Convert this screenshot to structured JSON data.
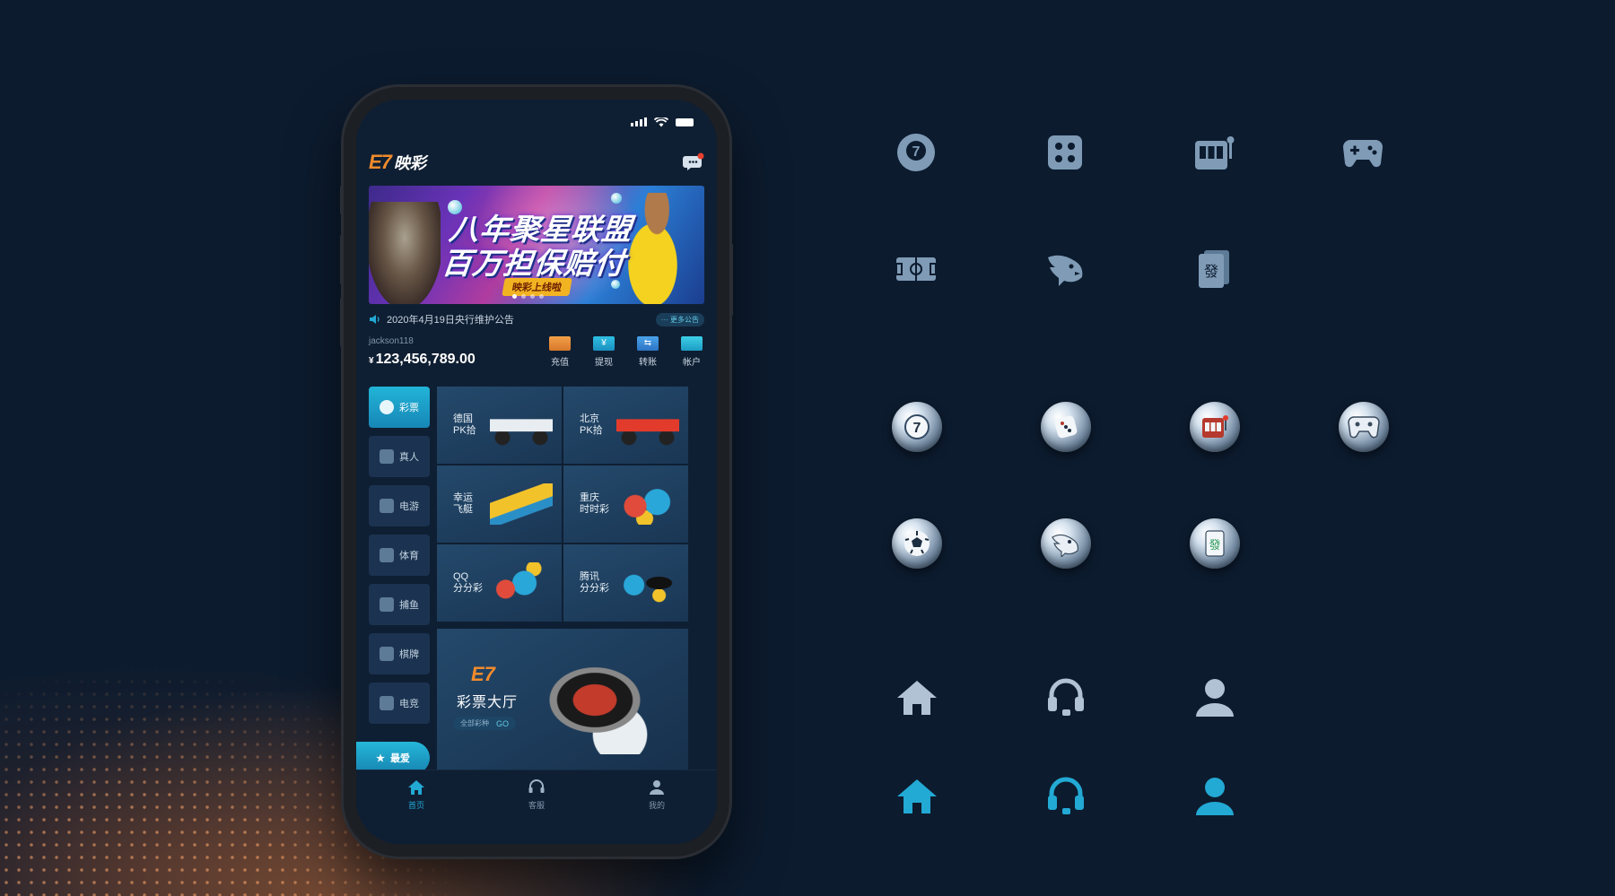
{
  "app": {
    "logo_mark": "E7",
    "logo_text": "映彩"
  },
  "banner": {
    "line1": "八年聚星联盟",
    "line2": "百万担保赔付",
    "tag": "映彩上线啦",
    "dots": 4,
    "active_dot": 1
  },
  "notice": {
    "text": "2020年4月19日央行维护公告",
    "more": "更多公告"
  },
  "account": {
    "username": "jackson118",
    "currency": "¥",
    "balance": "123,456,789.00",
    "actions": [
      {
        "label": "充值",
        "icon": "recharge-icon",
        "color": "#e58a32"
      },
      {
        "label": "提现",
        "icon": "withdraw-icon",
        "color": "#22a9d4"
      },
      {
        "label": "转账",
        "icon": "transfer-icon",
        "color": "#3b8fd8"
      },
      {
        "label": "帐户",
        "icon": "account-card-icon",
        "color": "#2bb8d8"
      }
    ]
  },
  "sidebar": {
    "items": [
      {
        "label": "彩票",
        "icon": "lottery-icon",
        "active": true
      },
      {
        "label": "真人",
        "icon": "live-casino-icon",
        "active": false
      },
      {
        "label": "电游",
        "icon": "slot-machine-icon",
        "active": false
      },
      {
        "label": "体育",
        "icon": "sports-field-icon",
        "active": false
      },
      {
        "label": "捕鱼",
        "icon": "fish-icon",
        "active": false
      },
      {
        "label": "棋牌",
        "icon": "mahjong-icon",
        "active": false
      },
      {
        "label": "电竞",
        "icon": "gamepad-icon",
        "active": false
      }
    ],
    "favorite": "最爱"
  },
  "games": [
    {
      "label": "德国\nPK拾",
      "art": "car1"
    },
    {
      "label": "北京\nPK拾",
      "art": "car2"
    },
    {
      "label": "幸运\n飞艇",
      "art": "boat"
    },
    {
      "label": "重庆\n时时彩",
      "art": "balls"
    },
    {
      "label": "QQ\n分分彩",
      "art": "qq"
    },
    {
      "label": "腾讯\n分分彩",
      "art": "tx"
    }
  ],
  "hall": {
    "logo": "E7",
    "title": "彩票大厅",
    "sub": "全部彩种",
    "go": "GO"
  },
  "tabbar": [
    {
      "label": "首页",
      "icon": "home-icon",
      "active": true
    },
    {
      "label": "客服",
      "icon": "headset-icon",
      "active": false
    },
    {
      "label": "我的",
      "icon": "user-icon",
      "active": false
    }
  ],
  "colors": {
    "background": "#0c1b2e",
    "accent": "#22a9d4",
    "brand_orange": "#f28b2b",
    "icon_flat": "#7f9bb6"
  },
  "showcase": {
    "flat_icons": [
      "lottery-ball-icon",
      "dice-grid-icon",
      "slot-machine-icon",
      "gamepad-icon",
      "sports-field-icon",
      "fish-icon",
      "mahjong-tile-icon"
    ],
    "sphere_icons": [
      "lottery-ball-sphere-icon",
      "dice-sphere-icon",
      "slot-machine-sphere-icon",
      "gamepad-sphere-icon",
      "soccer-ball-sphere-icon",
      "fish-sphere-icon",
      "mahjong-sphere-icon"
    ],
    "nav_icons_inactive": [
      "home-icon",
      "headset-icon",
      "user-icon"
    ],
    "nav_icons_active": [
      "home-icon",
      "headset-icon",
      "user-icon"
    ]
  }
}
